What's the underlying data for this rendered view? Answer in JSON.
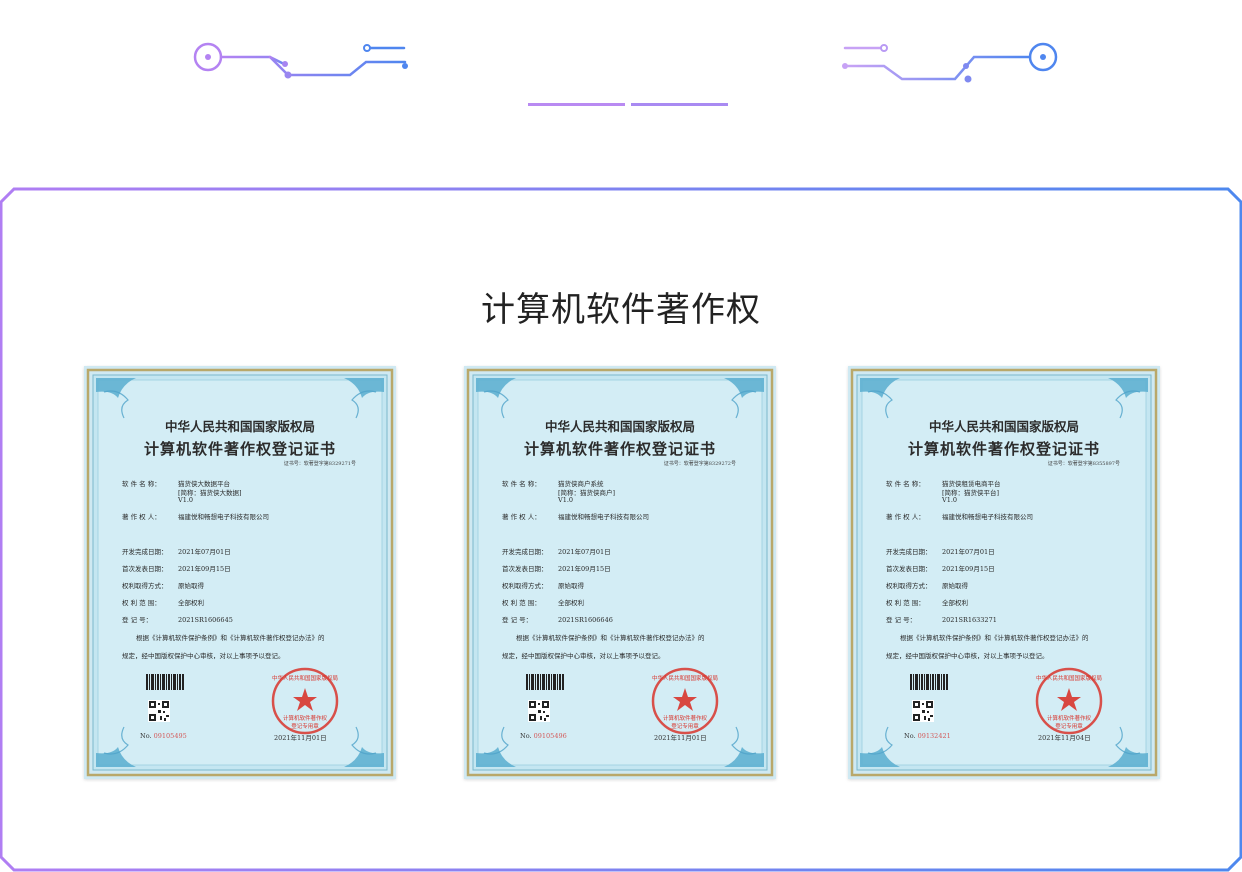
{
  "section": {
    "title": "计算机软件著作权"
  },
  "colors": {
    "purple": "#b483f2",
    "blue": "#4f86ef",
    "frame_gradient": [
      "#b07ef3",
      "#4d88ee"
    ]
  },
  "labels": {
    "title1": "中华人民共和国国家版权局",
    "title2": "计算机软件著作权登记证书",
    "cert_no_label": "证书号：",
    "software_name": "软 件 名 称：",
    "owner": "著 作 权 人：",
    "dev_date": "开发完成日期：",
    "pub_date": "首次发表日期：",
    "method": "权利取得方式：",
    "scope": "权 利 范 围：",
    "reg_no": "登   记   号：",
    "para1": "根据《计算机软件保护条例》和《计算机软件著作权登记办法》的",
    "para2": "规定，经中国版权保护中心审核，对以上事项予以登记。",
    "serial_prefix": "No.",
    "seal_line1": "中华人民共和国国家版权局",
    "seal_line2": "计算机软件著作权",
    "seal_line3": "登记专用章"
  },
  "certificates": [
    {
      "cert_no": "软著登字第8329271号",
      "software_name": "猫货侠大数据平台",
      "short_name": "[简称：猫货侠大数据]",
      "version": "V1.0",
      "owner": "福建悦和畅想电子科技有限公司",
      "dev_date": "2021年07月01日",
      "pub_date": "2021年09月15日",
      "method": "原始取得",
      "scope": "全部权利",
      "reg_no": "2021SR1606645",
      "serial": "09105495",
      "issue_date": "2021年11月01日"
    },
    {
      "cert_no": "软著登字第8329272号",
      "software_name": "猫货侠商户系统",
      "short_name": "[简称：猫货侠商户]",
      "version": "V1.0",
      "owner": "福建悦和畅想电子科技有限公司",
      "dev_date": "2021年07月01日",
      "pub_date": "2021年09月15日",
      "method": "原始取得",
      "scope": "全部权利",
      "reg_no": "2021SR1606646",
      "serial": "09105496",
      "issue_date": "2021年11月01日"
    },
    {
      "cert_no": "软著登字第8355897号",
      "software_name": "猫货侠租赁电商平台",
      "short_name": "[简称：猫货侠平台]",
      "version": "V1.0",
      "owner": "福建悦和畅想电子科技有限公司",
      "dev_date": "2021年07月01日",
      "pub_date": "2021年09月15日",
      "method": "原始取得",
      "scope": "全部权利",
      "reg_no": "2021SR1633271",
      "serial": "09132421",
      "issue_date": "2021年11月04日"
    }
  ]
}
